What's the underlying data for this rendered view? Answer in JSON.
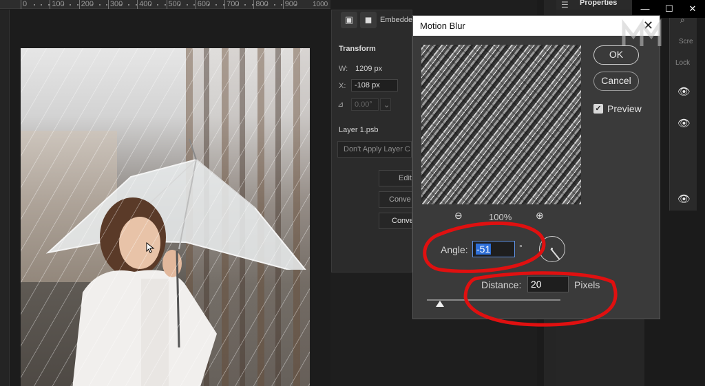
{
  "ruler": {
    "labels": [
      "0",
      "100",
      "200",
      "300",
      "400",
      "500",
      "600",
      "700",
      "800",
      "900"
    ],
    "last_label": "1000"
  },
  "properties_panel": {
    "title": "Properties",
    "embedded_label": "Embedde",
    "transform_heading": "Transform",
    "w_label": "W:",
    "w_value": "1209 px",
    "x_label": "X:",
    "x_value": "-108 px",
    "angle_value": "0.00°",
    "layer_name": "Layer 1.psb",
    "layer_comp_dropdown": "Don't Apply Layer C",
    "buttons": [
      "Edit",
      "Conve",
      "Conve"
    ]
  },
  "right_panel": {
    "search_text": "Scre",
    "lock_text": "Lock"
  },
  "window_controls": {
    "minimize": "—",
    "maximize": "☐",
    "close": "✕"
  },
  "dialog": {
    "title": "Motion Blur",
    "close": "✕",
    "ok_label": "OK",
    "cancel_label": "Cancel",
    "preview_label": "Preview",
    "preview_checked": true,
    "zoom_level": "100%",
    "angle_label": "Angle:",
    "angle_value": "-51",
    "angle_unit": "°",
    "distance_label": "Distance:",
    "distance_value": "20",
    "distance_unit": "Pixels",
    "distance_slider_fraction": 0.02
  },
  "colors": {
    "annotation_red": "#e01010",
    "selection_blue": "#2e6fd8"
  }
}
